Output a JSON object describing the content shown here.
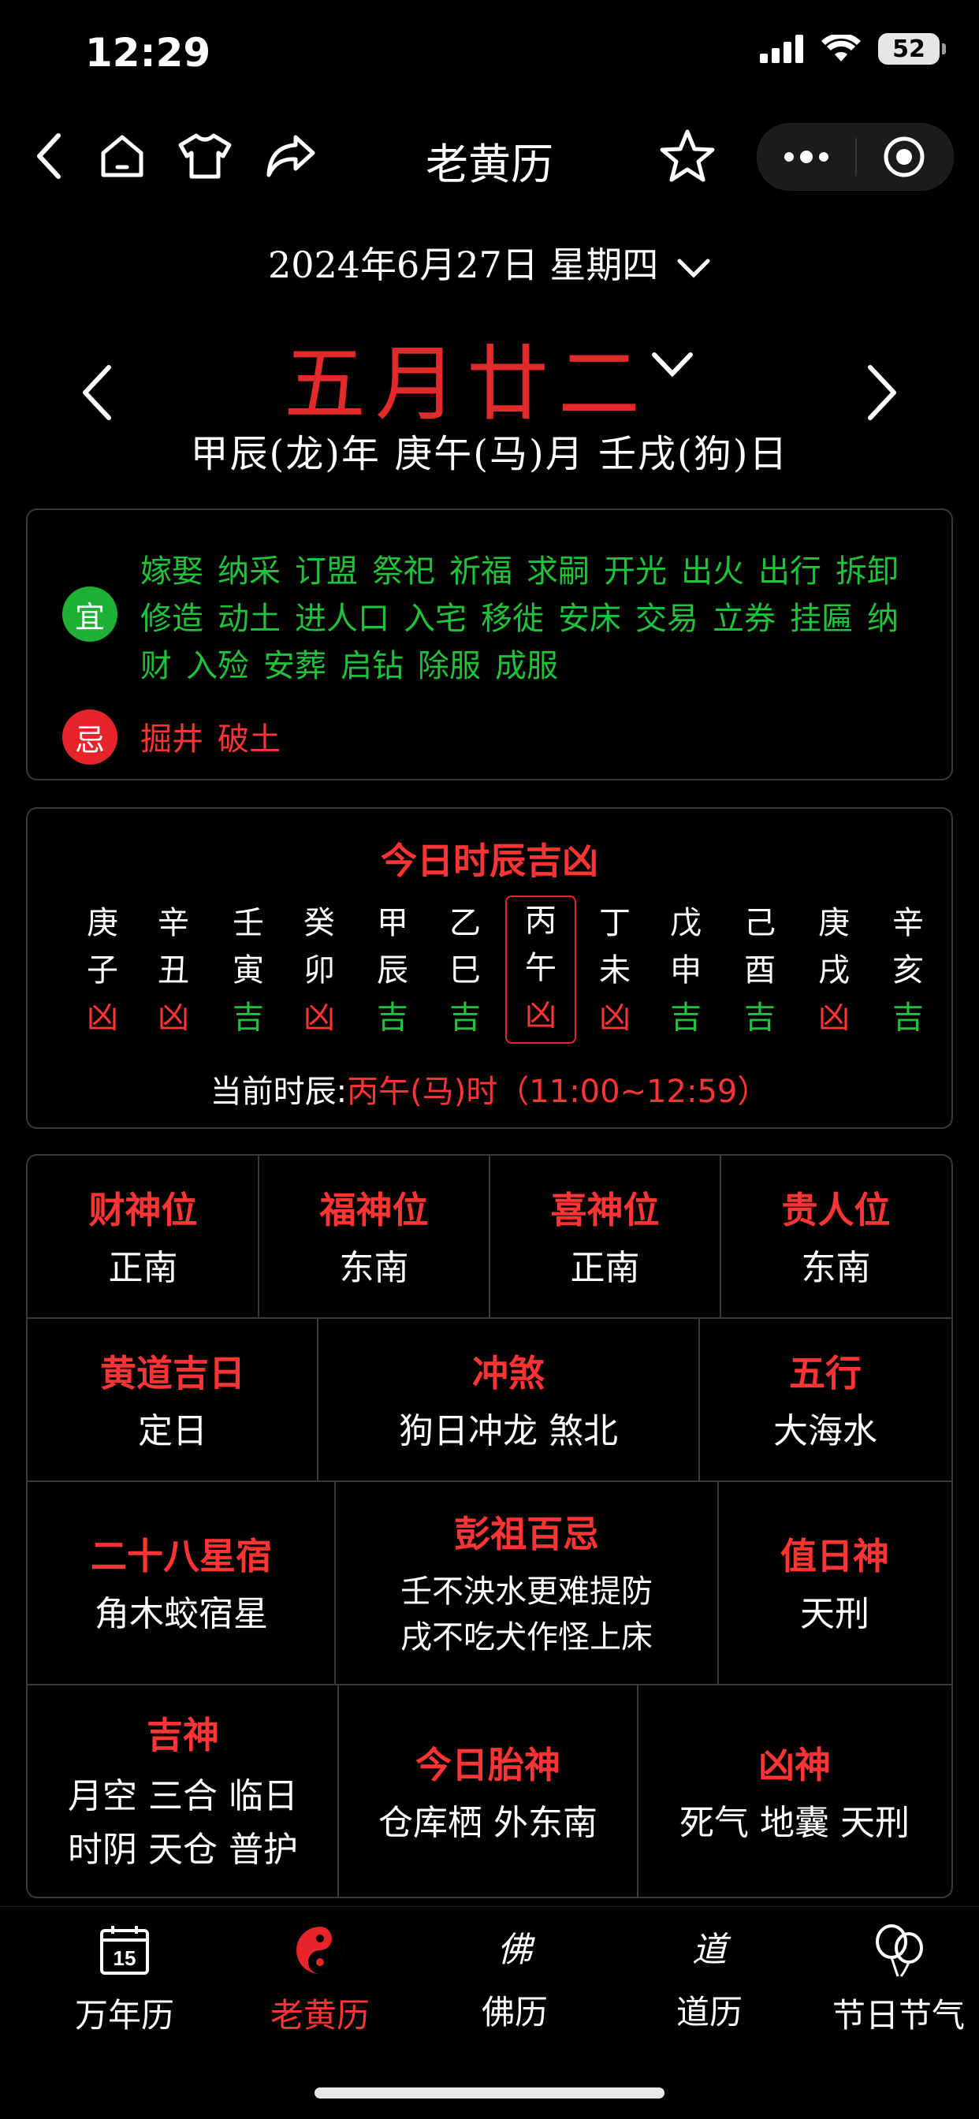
{
  "status": {
    "time": "12:29",
    "battery": "52"
  },
  "nav": {
    "title": "老黄历",
    "icons": [
      "back-icon",
      "home-icon",
      "shirt-icon",
      "share-icon",
      "star-icon",
      "more-icon",
      "record-icon"
    ]
  },
  "date": {
    "solar": "2024年6月27日  星期四",
    "lunar": "五月廿二",
    "ganzhi": "甲辰(龙)年 庚午(马)月 壬戌(狗)日"
  },
  "yi": {
    "label": "宜",
    "items": [
      "嫁娶",
      "纳采",
      "订盟",
      "祭祀",
      "祈福",
      "求嗣",
      "开光",
      "出火",
      "出行",
      "拆卸",
      "修造",
      "动土",
      "进人口",
      "入宅",
      "移徙",
      "安床",
      "交易",
      "立券",
      "挂匾",
      "纳财",
      "入殓",
      "安葬",
      "启钻",
      "除服",
      "成服"
    ]
  },
  "ji": {
    "label": "忌",
    "items": [
      "掘井",
      "破土"
    ]
  },
  "shichen": {
    "title": "今日时辰吉凶",
    "hours": [
      {
        "gan": "庚",
        "zhi": "子",
        "luck": "凶"
      },
      {
        "gan": "辛",
        "zhi": "丑",
        "luck": "凶"
      },
      {
        "gan": "壬",
        "zhi": "寅",
        "luck": "吉"
      },
      {
        "gan": "癸",
        "zhi": "卯",
        "luck": "凶"
      },
      {
        "gan": "甲",
        "zhi": "辰",
        "luck": "吉"
      },
      {
        "gan": "乙",
        "zhi": "巳",
        "luck": "吉"
      },
      {
        "gan": "丙",
        "zhi": "午",
        "luck": "凶"
      },
      {
        "gan": "丁",
        "zhi": "未",
        "luck": "凶"
      },
      {
        "gan": "戊",
        "zhi": "申",
        "luck": "吉"
      },
      {
        "gan": "己",
        "zhi": "酉",
        "luck": "吉"
      },
      {
        "gan": "庚",
        "zhi": "戌",
        "luck": "凶"
      },
      {
        "gan": "辛",
        "zhi": "亥",
        "luck": "吉"
      }
    ],
    "current_label": "当前时辰:",
    "current_value": "丙午(马)时（11:00~12:59）"
  },
  "grid": {
    "caishen": {
      "title": "财神位",
      "value": "正南"
    },
    "fushen": {
      "title": "福神位",
      "value": "东南"
    },
    "xishen": {
      "title": "喜神位",
      "value": "正南"
    },
    "guiren": {
      "title": "贵人位",
      "value": "东南"
    },
    "huangdao": {
      "title": "黄道吉日",
      "value": "定日"
    },
    "chongsha": {
      "title": "冲煞",
      "value": "狗日冲龙 煞北"
    },
    "wuxing": {
      "title": "五行",
      "value": "大海水"
    },
    "xingxiu": {
      "title": "二十八星宿",
      "value": "角木蛟宿星"
    },
    "pengzu": {
      "title": "彭祖百忌",
      "line1": "壬不泱水更难提防",
      "line2": "戌不吃犬作怪上床"
    },
    "zhishen": {
      "title": "值日神",
      "value": "天刑"
    },
    "jishen": {
      "title": "吉神",
      "line1": "月空 三合 临日",
      "line2": "时阴 天仓 普护"
    },
    "taishen": {
      "title": "今日胎神",
      "value": "仓库栖 外东南"
    },
    "xiongshen": {
      "title": "凶神",
      "value": "死气 地囊 天刑"
    }
  },
  "tabs": [
    {
      "label": "万年历",
      "icon": "calendar-icon",
      "day": "15"
    },
    {
      "label": "老黄历",
      "icon": "yinyang-icon"
    },
    {
      "label": "佛历",
      "icon": "fo-icon",
      "glyph": "佛"
    },
    {
      "label": "道历",
      "icon": "dao-icon",
      "glyph": "道"
    },
    {
      "label": "节日节气",
      "icon": "balloon-icon"
    }
  ],
  "colors": {
    "red": "#e5252a",
    "green": "#1fb135",
    "bg": "#000000"
  }
}
